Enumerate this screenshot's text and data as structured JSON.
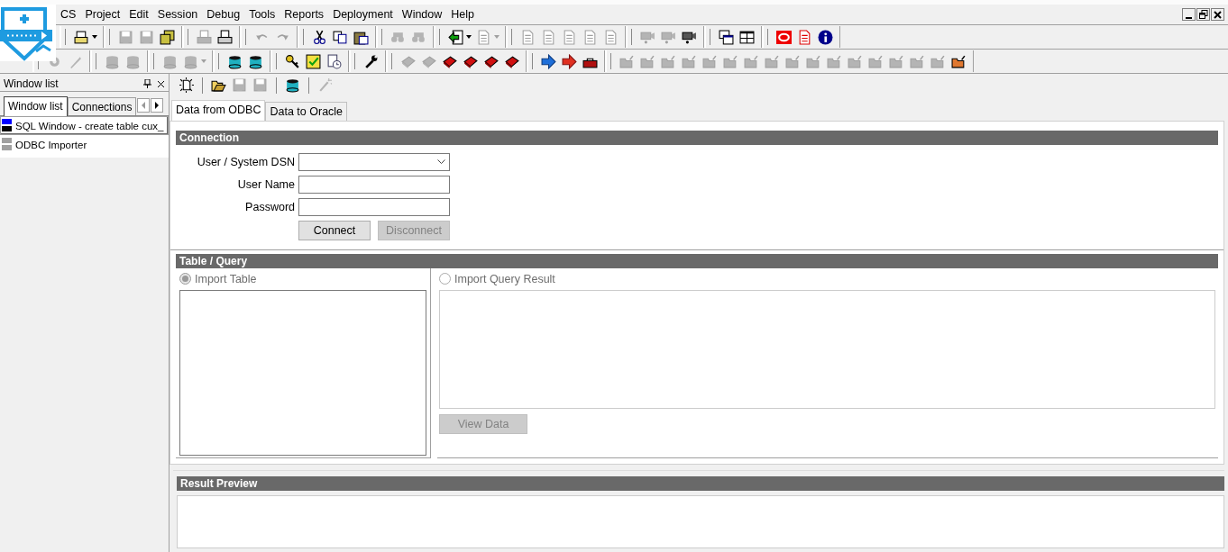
{
  "menu": {
    "items": [
      "CS",
      "Project",
      "Edit",
      "Session",
      "Debug",
      "Tools",
      "Reports",
      "Deployment",
      "Window",
      "Help"
    ]
  },
  "toolbars": [
    {
      "groups": [
        [
          {
            "disabled": false,
            "dropdown": true
          }
        ],
        [
          {
            "disabled": true,
            "dropdown": false
          },
          {
            "disabled": true,
            "dropdown": false
          },
          {
            "disabled": false,
            "dropdown": false
          }
        ],
        [
          {
            "disabled": true,
            "dropdown": false
          },
          {
            "disabled": false,
            "dropdown": false
          }
        ],
        [
          {
            "disabled": true,
            "dropdown": false
          },
          {
            "disabled": true,
            "dropdown": false
          }
        ],
        [
          {
            "disabled": false,
            "dropdown": false
          },
          {
            "disabled": false,
            "dropdown": false
          },
          {
            "disabled": false,
            "dropdown": false
          }
        ],
        [
          {
            "disabled": true,
            "dropdown": false
          },
          {
            "disabled": true,
            "dropdown": false
          }
        ],
        [
          {
            "disabled": false,
            "dropdown": true
          },
          {
            "disabled": true,
            "dropdown": true
          }
        ],
        [
          {
            "disabled": true,
            "dropdown": false
          },
          {
            "disabled": true,
            "dropdown": false
          },
          {
            "disabled": true,
            "dropdown": false
          },
          {
            "disabled": true,
            "dropdown": false
          },
          {
            "disabled": true,
            "dropdown": false
          }
        ],
        [
          {
            "disabled": true,
            "dropdown": false
          },
          {
            "disabled": true,
            "dropdown": false
          },
          {
            "disabled": false,
            "dropdown": false
          }
        ],
        [
          {
            "disabled": false,
            "dropdown": false
          },
          {
            "disabled": false,
            "dropdown": false
          }
        ],
        [
          {
            "disabled": false,
            "dropdown": false
          },
          {
            "disabled": false,
            "dropdown": false
          },
          {
            "disabled": false,
            "dropdown": false
          }
        ]
      ]
    },
    {
      "groups": [
        [
          {
            "disabled": true,
            "dropdown": false
          },
          {
            "disabled": true,
            "dropdown": false
          }
        ],
        [
          {
            "disabled": true,
            "dropdown": false
          },
          {
            "disabled": true,
            "dropdown": false
          }
        ],
        [
          {
            "disabled": true,
            "dropdown": false
          },
          {
            "disabled": true,
            "dropdown": true
          }
        ],
        [
          {
            "disabled": false,
            "dropdown": false
          },
          {
            "disabled": false,
            "dropdown": false
          }
        ],
        [
          {
            "disabled": false,
            "dropdown": false
          },
          {
            "disabled": false,
            "dropdown": false
          },
          {
            "disabled": false,
            "dropdown": false
          }
        ],
        [
          {
            "disabled": false,
            "dropdown": false
          }
        ],
        [
          {
            "disabled": true,
            "dropdown": false
          },
          {
            "disabled": true,
            "dropdown": false
          },
          {
            "disabled": false,
            "dropdown": false
          },
          {
            "disabled": false,
            "dropdown": false
          },
          {
            "disabled": false,
            "dropdown": false
          },
          {
            "disabled": false,
            "dropdown": false
          }
        ],
        [
          {
            "disabled": false,
            "dropdown": false
          },
          {
            "disabled": false,
            "dropdown": false
          },
          {
            "disabled": false,
            "dropdown": false
          }
        ],
        [
          {
            "disabled": true,
            "dropdown": false
          },
          {
            "disabled": true,
            "dropdown": false
          },
          {
            "disabled": true,
            "dropdown": false
          },
          {
            "disabled": true,
            "dropdown": false
          },
          {
            "disabled": true,
            "dropdown": false
          },
          {
            "disabled": true,
            "dropdown": false
          },
          {
            "disabled": true,
            "dropdown": false
          },
          {
            "disabled": true,
            "dropdown": false
          },
          {
            "disabled": true,
            "dropdown": false
          },
          {
            "disabled": true,
            "dropdown": false
          },
          {
            "disabled": true,
            "dropdown": false
          },
          {
            "disabled": true,
            "dropdown": false
          },
          {
            "disabled": true,
            "dropdown": false
          },
          {
            "disabled": true,
            "dropdown": false
          },
          {
            "disabled": true,
            "dropdown": false
          },
          {
            "disabled": true,
            "dropdown": false
          },
          {
            "disabled": false,
            "dropdown": false
          }
        ]
      ]
    }
  ],
  "window_list": {
    "title": "Window list",
    "tabs": [
      {
        "label": "Window list",
        "selected": true
      },
      {
        "label": "Connections",
        "selected": false
      }
    ],
    "items": [
      {
        "label": "SQL Window - create table cux_",
        "selected": true,
        "color": "#0000ff"
      },
      {
        "label": "ODBC Importer",
        "selected": false,
        "color": "#a0a0a0"
      }
    ]
  },
  "importer": {
    "toolbar": {
      "groups": [
        [
          {
            "disabled": false,
            "dropdown": false
          }
        ],
        [
          {
            "disabled": false,
            "dropdown": false
          },
          {
            "disabled": true,
            "dropdown": false
          },
          {
            "disabled": true,
            "dropdown": false
          }
        ],
        [
          {
            "disabled": false,
            "dropdown": false
          }
        ],
        [
          {
            "disabled": true,
            "dropdown": false
          }
        ]
      ]
    },
    "tabs": [
      {
        "label": "Data from ODBC",
        "selected": true
      },
      {
        "label": "Data to Oracle",
        "selected": false
      }
    ],
    "connection": {
      "title": "Connection",
      "fields": [
        {
          "kind": "dropdown",
          "label": "User / System DSN"
        },
        {
          "kind": "text",
          "label": "User Name"
        },
        {
          "kind": "password",
          "label": "Password"
        }
      ],
      "buttons": [
        {
          "label": "Connect",
          "disabled": false
        },
        {
          "label": "Disconnect",
          "disabled": true
        }
      ]
    },
    "table_query": {
      "title": "Table / Query",
      "options": [
        {
          "label": "Import Table",
          "selected": true,
          "disabled": true
        },
        {
          "label": "Import Query Result",
          "selected": false,
          "disabled": true
        }
      ],
      "buttons": [
        {
          "label": "View Data",
          "disabled": true
        }
      ]
    },
    "result_preview": {
      "title": "Result Preview"
    }
  }
}
